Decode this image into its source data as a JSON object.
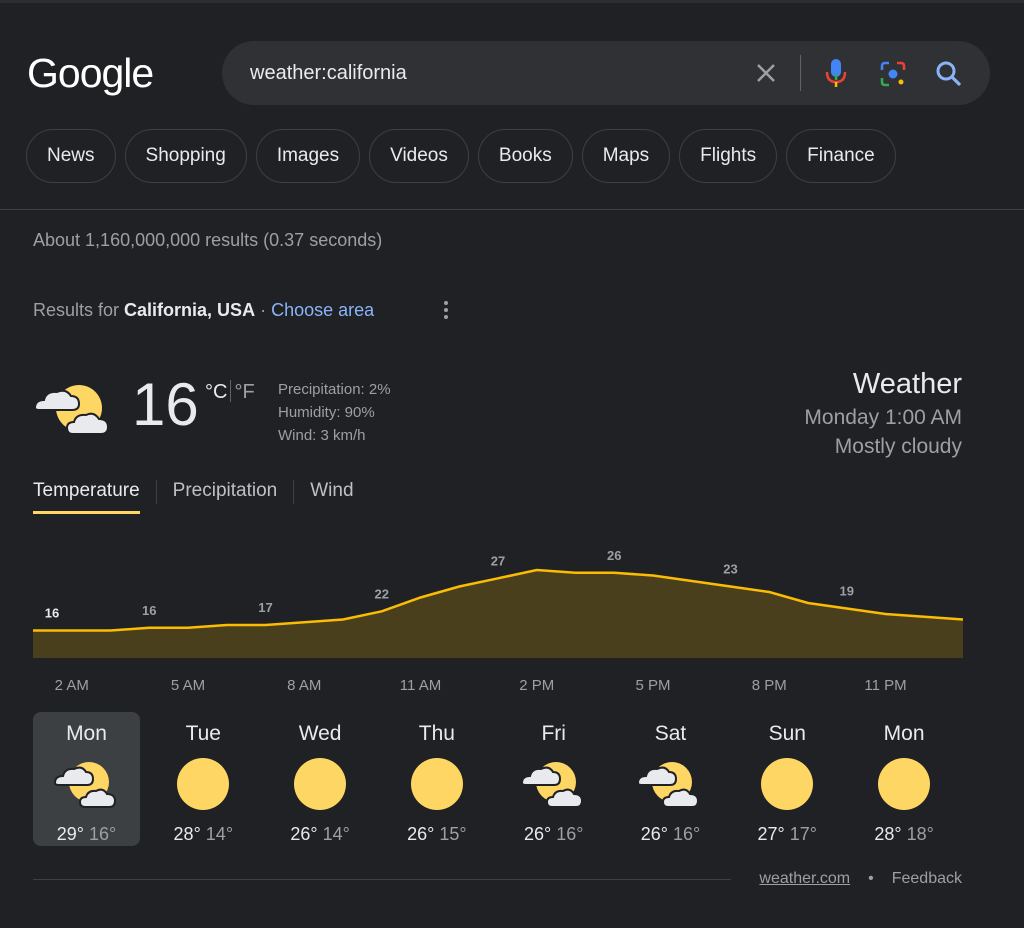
{
  "logo": "Google",
  "search": {
    "query": "weather:california"
  },
  "chips": [
    "News",
    "Shopping",
    "Images",
    "Videos",
    "Books",
    "Maps",
    "Flights",
    "Finance"
  ],
  "stats": "About 1,160,000,000 results (0.37 seconds)",
  "results_for": {
    "prefix": "Results for",
    "location": "California, USA",
    "separator": "·",
    "link": "Choose area"
  },
  "current": {
    "temp": "16",
    "unit_c": "°C",
    "unit_f": "°F",
    "precipitation": "Precipitation: 2%",
    "humidity": "Humidity: 90%",
    "wind": "Wind: 3 km/h",
    "icon": "partly-cloudy-icon"
  },
  "header": {
    "title": "Weather",
    "time": "Monday 1:00 AM",
    "condition": "Mostly cloudy"
  },
  "tabs": [
    "Temperature",
    "Precipitation",
    "Wind"
  ],
  "chart_data": {
    "type": "area",
    "x": [
      "1 AM",
      "2 AM",
      "3 AM",
      "4 AM",
      "5 AM",
      "6 AM",
      "7 AM",
      "8 AM",
      "9 AM",
      "10 AM",
      "11 AM",
      "12 PM",
      "1 PM",
      "2 PM",
      "3 PM",
      "4 PM",
      "5 PM",
      "6 PM",
      "7 PM",
      "8 PM",
      "9 PM",
      "10 PM",
      "11 PM",
      "12 AM",
      "1 AM"
    ],
    "values": [
      16,
      16,
      16,
      16.5,
      16.5,
      17,
      17,
      17.5,
      18,
      19.5,
      22,
      24,
      25.5,
      27,
      26.5,
      26.5,
      26,
      25,
      24,
      23,
      21,
      20,
      19,
      18.5,
      18
    ],
    "tick_labels": [
      "2 AM",
      "5 AM",
      "8 AM",
      "11 AM",
      "2 PM",
      "5 PM",
      "8 PM",
      "11 PM"
    ],
    "labels": [
      {
        "hour": "1 AM",
        "value": "16"
      },
      {
        "hour": "4 AM",
        "value": "16"
      },
      {
        "hour": "7 AM",
        "value": "17"
      },
      {
        "hour": "10 AM",
        "value": "22"
      },
      {
        "hour": "1 PM",
        "value": "27"
      },
      {
        "hour": "4 PM",
        "value": "26"
      },
      {
        "hour": "7 PM",
        "value": "23"
      },
      {
        "hour": "10 PM",
        "value": "19"
      }
    ],
    "ylim": [
      11,
      27
    ],
    "colors": {
      "line": "#fbbc04",
      "fill": "#4a3f1c"
    }
  },
  "forecast": [
    {
      "day": "Mon",
      "hi": "29°",
      "lo": "16°",
      "icon": "partly-cloudy-icon",
      "selected": true
    },
    {
      "day": "Tue",
      "hi": "28°",
      "lo": "14°",
      "icon": "sunny-icon"
    },
    {
      "day": "Wed",
      "hi": "26°",
      "lo": "14°",
      "icon": "sunny-icon"
    },
    {
      "day": "Thu",
      "hi": "26°",
      "lo": "15°",
      "icon": "sunny-icon"
    },
    {
      "day": "Fri",
      "hi": "26°",
      "lo": "16°",
      "icon": "partly-cloudy-icon"
    },
    {
      "day": "Sat",
      "hi": "26°",
      "lo": "16°",
      "icon": "partly-cloudy-icon"
    },
    {
      "day": "Sun",
      "hi": "27°",
      "lo": "17°",
      "icon": "sunny-icon"
    },
    {
      "day": "Mon",
      "hi": "28°",
      "lo": "18°",
      "icon": "sunny-icon"
    }
  ],
  "footer": {
    "source": "weather.com",
    "dot": "•",
    "feedback": "Feedback"
  }
}
